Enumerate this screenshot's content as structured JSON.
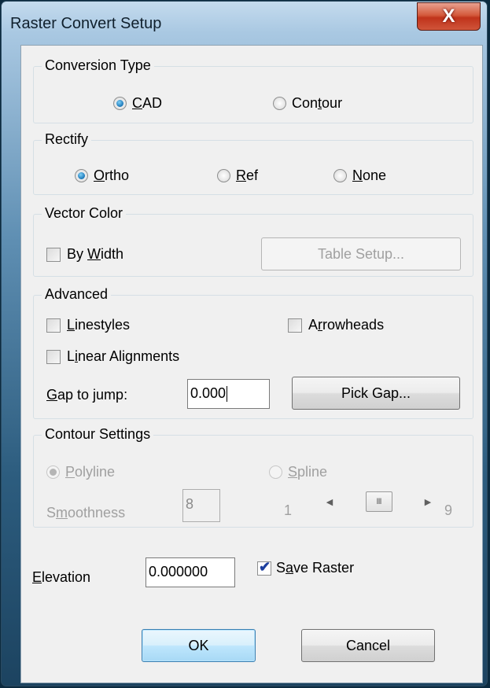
{
  "window": {
    "title": "Raster Convert Setup",
    "close_glyph": "X"
  },
  "conversion_type": {
    "title": "Conversion Type",
    "options": [
      {
        "label": "CAD",
        "mnemonic": "C",
        "rest": "AD",
        "checked": true
      },
      {
        "label": "Contour",
        "pre": "Con",
        "mnemonic": "t",
        "rest": "our",
        "checked": false
      }
    ]
  },
  "rectify": {
    "title": "Rectify",
    "options": [
      {
        "label": "Ortho",
        "mnemonic": "O",
        "rest": "rtho",
        "checked": true
      },
      {
        "label": "Ref",
        "mnemonic": "R",
        "rest": "ef",
        "checked": false
      },
      {
        "label": "None",
        "mnemonic": "N",
        "rest": "one",
        "checked": false
      }
    ]
  },
  "vector_color": {
    "title": "Vector Color",
    "by_width": {
      "pre": "By ",
      "mnemonic": "W",
      "rest": "idth",
      "checked": false
    },
    "table_setup_label": "Table Setup..."
  },
  "advanced": {
    "title": "Advanced",
    "linestyles": {
      "mnemonic": "L",
      "rest": "inestyles",
      "checked": false
    },
    "arrowheads": {
      "pre": "A",
      "mnemonic": "r",
      "rest": "rowheads",
      "checked": false
    },
    "linear_alignments": {
      "pre": "L",
      "mnemonic": "i",
      "rest": "near Alignments",
      "checked": false
    },
    "gap_label": {
      "mnemonic": "G",
      "rest": "ap to jump:"
    },
    "gap_value": "0.000",
    "pick_gap_label": "Pick Gap..."
  },
  "contour_settings": {
    "title": "Contour Settings",
    "polyline": {
      "mnemonic": "P",
      "rest": "olyline",
      "checked": true
    },
    "spline": {
      "mnemonic": "S",
      "rest": "pline",
      "checked": false
    },
    "smoothness_label": {
      "pre": "S",
      "mnemonic": "m",
      "rest": "oothness"
    },
    "smoothness_value": "8",
    "range_min": "1",
    "range_max": "9",
    "thumb_glyph": "III",
    "slider_level": 0.5
  },
  "elevation": {
    "label": {
      "mnemonic": "E",
      "rest": "levation"
    },
    "value": "0.000000"
  },
  "save_raster": {
    "pre": "S",
    "mnemonic": "a",
    "rest": "ve Raster",
    "checked": true
  },
  "buttons": {
    "ok": "OK",
    "cancel": "Cancel"
  },
  "colors": {
    "accent": "#1a76b7",
    "close": "#c0331b",
    "disabled_text": "#a0a0a0"
  }
}
